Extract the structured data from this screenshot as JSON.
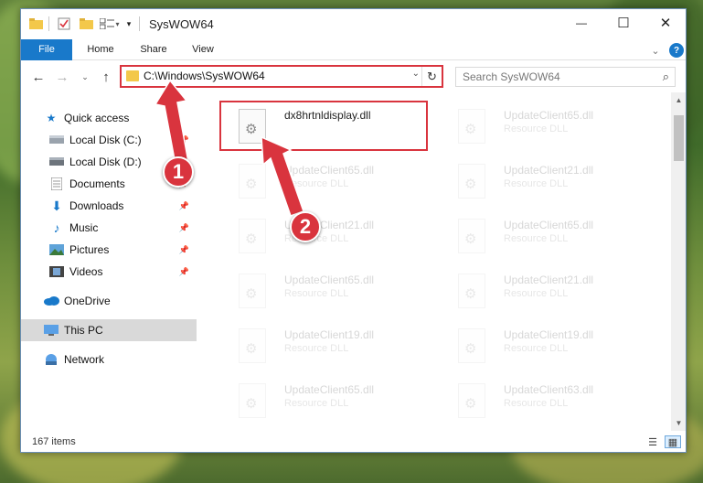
{
  "window": {
    "title": "SysWOW64",
    "controls": {
      "minimize": "—",
      "maximize": "☐",
      "close": "✕"
    }
  },
  "ribbon": {
    "tabs": [
      "File",
      "Home",
      "Share",
      "View"
    ]
  },
  "nav": {
    "address": "C:\\Windows\\SysWOW64",
    "search_placeholder": "Search SysWOW64"
  },
  "sidebar": {
    "items": [
      {
        "label": "Quick access",
        "icon": "star-icon"
      },
      {
        "label": "Local Disk (C:)",
        "icon": "drive-icon",
        "pinned": true
      },
      {
        "label": "Local Disk (D:)",
        "icon": "drive-icon",
        "pinned": true
      },
      {
        "label": "Documents",
        "icon": "documents-icon",
        "pinned": true
      },
      {
        "label": "Downloads",
        "icon": "download-icon",
        "pinned": true
      },
      {
        "label": "Music",
        "icon": "music-icon",
        "pinned": true
      },
      {
        "label": "Pictures",
        "icon": "pictures-icon",
        "pinned": true
      },
      {
        "label": "Videos",
        "icon": "videos-icon",
        "pinned": true
      },
      {
        "label": "OneDrive",
        "icon": "cloud-icon"
      },
      {
        "label": "This PC",
        "icon": "computer-icon",
        "selected": true
      },
      {
        "label": "Network",
        "icon": "network-icon"
      }
    ]
  },
  "files": {
    "highlighted": {
      "name": "dx8hrtnldisplay.dll"
    },
    "faded": [
      {
        "name": "UpdateClient65.dll",
        "type": "Resource DLL"
      },
      {
        "name": "UpdateClient65.dll",
        "type": "Resource DLL"
      },
      {
        "name": "UpdateClient21.dll",
        "type": "Resource DLL"
      },
      {
        "name": "UpdateClient21.dll",
        "type": "Resource DLL"
      },
      {
        "name": "UpdateClient65.dll",
        "type": "Resource DLL"
      },
      {
        "name": "UpdateClient65.dll",
        "type": "Resource DLL"
      },
      {
        "name": "UpdateClient21.dll",
        "type": "Resource DLL"
      },
      {
        "name": "UpdateClient19.dll",
        "type": "Resource DLL"
      },
      {
        "name": "UpdateClient19.dll",
        "type": "Resource DLL"
      },
      {
        "name": "UpdateClient65.dll",
        "type": "Resource DLL"
      },
      {
        "name": "UpdateClient63.dll",
        "type": "Resource DLL"
      }
    ]
  },
  "status": {
    "items": "167 items"
  },
  "annotations": {
    "badge1": "1",
    "badge2": "2"
  },
  "colors": {
    "accent": "#1979ca",
    "highlight": "#d9343e"
  }
}
